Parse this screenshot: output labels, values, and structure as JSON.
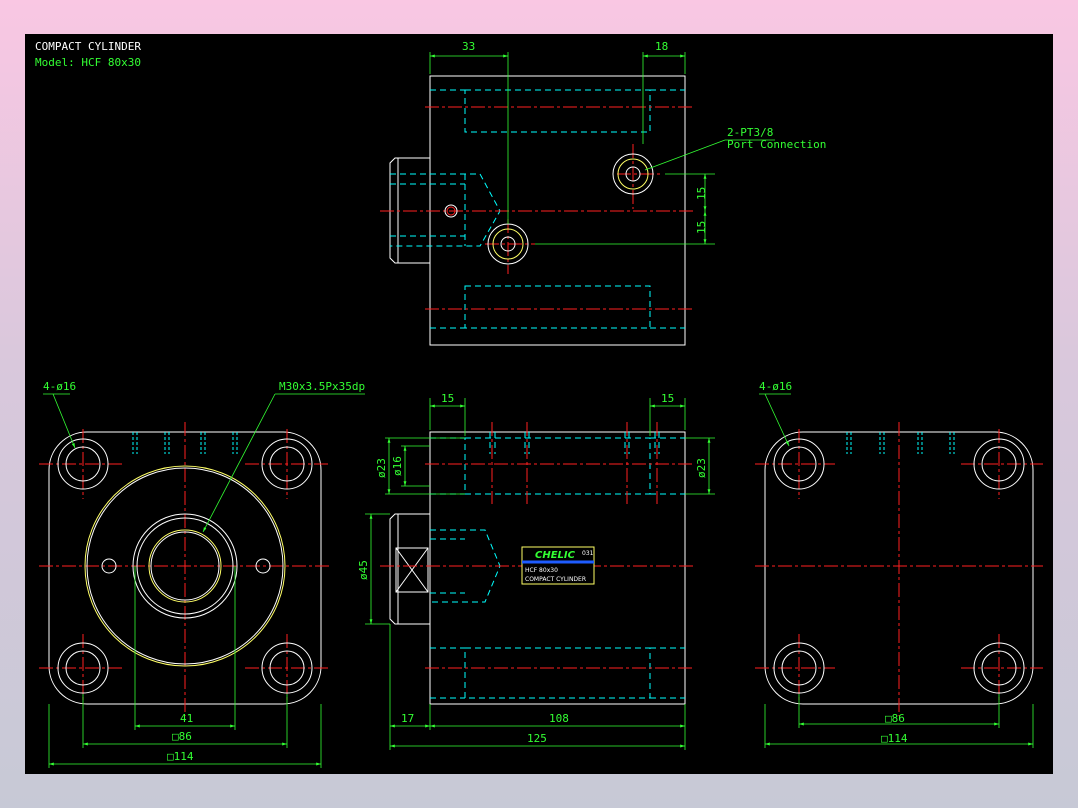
{
  "header": {
    "title": "COMPACT CYLINDER",
    "model": "Model: HCF 80x30"
  },
  "top_view": {
    "dim_33": "33",
    "dim_18": "18",
    "port_label": "2-PT3/8",
    "port_sub": "Port Connection",
    "dim_15a": "15",
    "dim_15b": "15"
  },
  "front_view": {
    "holes_label": "4-ø16",
    "thread_label": "M30x3.5Px35dp",
    "dim_41": "41",
    "dim_86": "□86",
    "dim_114": "□114"
  },
  "side_view": {
    "dim_15_left": "15",
    "dim_15_right": "15",
    "dim_23_left": "ø23",
    "dim_16": "ø16",
    "dim_23_right": "ø23",
    "dim_45": "ø45",
    "dim_17": "17",
    "dim_108": "108",
    "dim_125": "125",
    "nameplate": {
      "brand": "CHELIC",
      "mark": "031",
      "model": "HCF 80x30",
      "desc": "COMPACT CYLINDER"
    }
  },
  "rear_view": {
    "holes_label": "4-ø16",
    "dim_86": "□86",
    "dim_114": "□114"
  },
  "colors": {
    "background": "#000000",
    "outline": "#ffffff",
    "hidden": "#00ffff",
    "center": "#ff2020",
    "dimension": "#33ff33",
    "highlight": "#ffff66"
  }
}
